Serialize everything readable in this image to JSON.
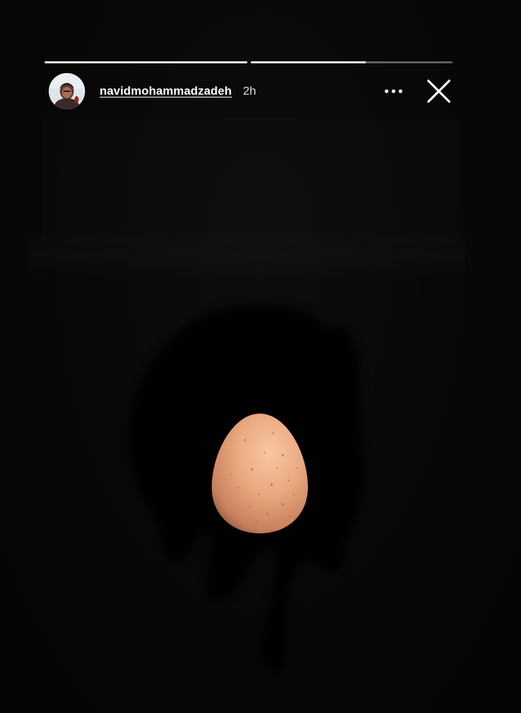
{
  "story": {
    "progress": [
      1.0,
      0.57
    ],
    "user": {
      "username": "navidmohammadzadeh",
      "time_ago": "2h",
      "avatar_icon": "profile-avatar"
    },
    "icons": {
      "more": "more-horizontal-icon",
      "close": "close-icon"
    },
    "content": {
      "subject": "egg",
      "egg_color": "#e9a57f"
    },
    "colors": {
      "background": "#050505",
      "progress_active": "#e9e9e9",
      "progress_track": "rgba(255,255,255,0.35)"
    }
  }
}
